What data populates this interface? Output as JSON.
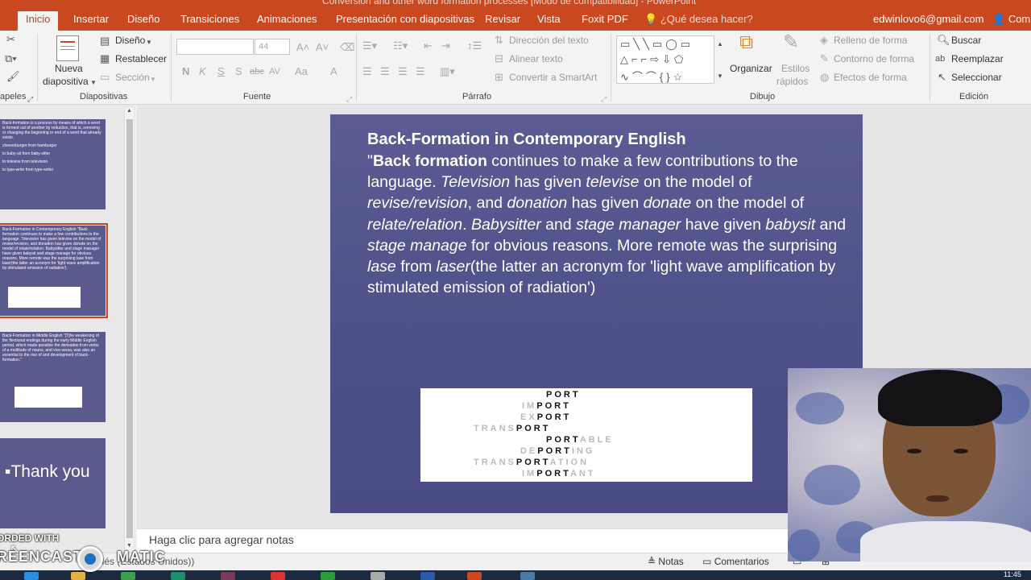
{
  "window": {
    "title": "Conversion and other word formation processes [Modo de compatibilidad] - PowerPoint"
  },
  "tabs": [
    "Inicio",
    "Insertar",
    "Diseño",
    "Transiciones",
    "Animaciones",
    "Presentación con diapositivas",
    "Revisar",
    "Vista",
    "Foxit PDF"
  ],
  "tell_me": "¿Qué desea hacer?",
  "account": "edwinlovo6@gmail.com",
  "share": "Comp",
  "ribbon": {
    "portapapeles": "apeles",
    "diapositivas": {
      "label": "Diapositivas",
      "nueva_1": "Nueva",
      "nueva_2": "diapositiva",
      "diseno": "Diseño",
      "restablecer": "Restablecer",
      "seccion": "Sección"
    },
    "fuente": {
      "label": "Fuente",
      "font_name": "",
      "font_size": "44",
      "bold": "N",
      "italic": "K",
      "underline": "S",
      "shadow": "S",
      "strike": "abc",
      "spacing": "AV",
      "case": "Aa",
      "color": "A"
    },
    "parrafo": {
      "label": "Párrafo",
      "direccion": "Dirección del texto",
      "alinear": "Alinear texto",
      "smartart": "Convertir a SmartArt"
    },
    "dibujo": {
      "label": "Dibujo",
      "organizar": "Organizar",
      "estilos_1": "Estilos",
      "estilos_2": "rápidos",
      "relleno": "Relleno de forma",
      "contorno": "Contorno de forma",
      "efectos": "Efectos de forma"
    },
    "edicion": {
      "label": "Edición",
      "buscar": "Buscar",
      "reemplazar": "Reemplazar",
      "seleccionar": "Seleccionar"
    }
  },
  "thumbnails": {
    "slide1": [
      "Back-formation is a process by means of which a word is formed out of another by reduction, that is, removing or changing the beginning or end of a word that already exists.",
      "cheeseburger from hamburger",
      "to baby-sit from baby-sitter",
      "to televise from television",
      "to type-write from type-writer"
    ],
    "slide2": "Back-Formation in Contemporary English \"Back formation continues to make a few contributions to the language. Television has given televise on the model of revise/revision, and donation has given donate on the model of relate/relation. Babysitter and stage manager have given babysit and stage manage for obvious reasons. More remote was the surprising lase from laser(the latter an acronym for 'light wave amplification by stimulated emission of radiation').",
    "slide3": "Back-Formation in Middle English \"[T]he weakening of the flectional endings during the early Middle English period, which made possible the derivation from verbs of a multitude of nouns, and vice-versa, was also an essential to the rise of and development of back-formation.\"",
    "slide4": "Thank you"
  },
  "slide": {
    "title": "Back-Formation in Contemporary English",
    "body": {
      "q": "\"",
      "s1": "Back formation",
      "s2": " continues to make a few contributions to the language. ",
      "s3": "Television",
      "s4": " has given ",
      "s5": "televise",
      "s6": " on the model of ",
      "s7": "revise/revision",
      "s8": ", and ",
      "s9": "donation",
      "s10": " has given ",
      "s11": "donate",
      "s12": " on the model of ",
      "s13": "relate/relation",
      "s14": ". ",
      "s15": "Babysitter",
      "s16": " and ",
      "s17": "stage manager",
      "s18": " have given ",
      "s19": "babysit",
      "s20": " and ",
      "s21": "stage manage",
      "s22": " for obvious reasons. More remote was the surprising ",
      "s23": "lase",
      "s24": " from ",
      "s25": "laser",
      "s26": "(the latter an acronym for 'light wave amplification by stimulated emission of radiation')"
    },
    "image_words": [
      {
        "pre": "",
        "root": "PORT",
        "post": ""
      },
      {
        "pre": "IM",
        "root": "PORT",
        "post": ""
      },
      {
        "pre": "EX",
        "root": "PORT",
        "post": ""
      },
      {
        "pre": "TRANS",
        "root": "PORT",
        "post": ""
      },
      {
        "pre": "",
        "root": "PORT",
        "post": "ABLE"
      },
      {
        "pre": "DE",
        "root": "PORT",
        "post": "ING"
      },
      {
        "pre": "TRANS",
        "root": "PORT",
        "post": "ATION"
      },
      {
        "pre": "IM",
        "root": "PORT",
        "post": "ANT"
      }
    ]
  },
  "notes_placeholder": "Haga clic para agregar notas",
  "status": {
    "language": "Inglés (Estados Unidos)",
    "notas": "Notas",
    "comentarios": "Comentarios"
  },
  "watermark": {
    "line1": "ORDED WITH",
    "line2": "REENCAST",
    "line3": "MATIC"
  },
  "clock": "11:45"
}
